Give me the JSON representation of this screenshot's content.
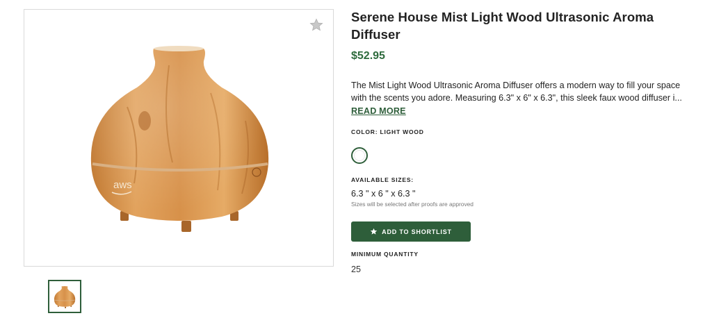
{
  "product": {
    "title": "Serene House Mist Light Wood Ultrasonic Aroma Diffuser",
    "price": "$52.95",
    "description": "The Mist Light Wood Ultrasonic Aroma Diffuser offers a modern way to fill your space with the scents you adore. Measuring 6.3\" x 6\" x 6.3\", this sleek faux wood diffuser i...",
    "read_more_label": "READ MORE",
    "image_logo_text": "aws"
  },
  "color": {
    "label": "COLOR: LIGHT WOOD",
    "swatch_color": "#ffffff"
  },
  "sizes": {
    "label": "AVAILABLE SIZES:",
    "value": "6.3 \" x 6 \" x 6.3 \"",
    "note": "Sizes will be selected after proofs are approved"
  },
  "actions": {
    "shortlist_label": "ADD TO SHORTLIST",
    "shortlist_icon": "star-icon"
  },
  "quantity": {
    "label": "MINIMUM QUANTITY",
    "value": "25"
  },
  "icons": {
    "favorite": "star-outline-icon"
  },
  "colors": {
    "accent": "#2e5e3a",
    "price": "#2e6b3d",
    "wood_light": "#e0a058",
    "wood_dark": "#b86f2a"
  }
}
